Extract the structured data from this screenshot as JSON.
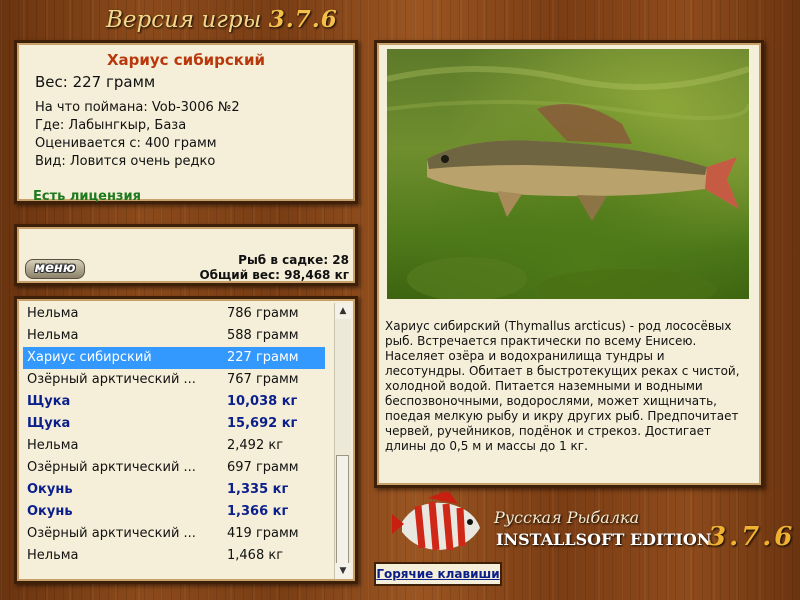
{
  "header": {
    "version_label": "Версия игры",
    "version_number": "3.7.6"
  },
  "catch": {
    "name": "Хариус сибирский",
    "weight": "Вес: 227 грамм",
    "bait": "На что поймана: Vob-3006 №2",
    "location": "Где: Лабынгкыр, База",
    "value": "Оценивается с: 400 грамм",
    "rarity": "Вид: Ловится очень редко",
    "license": "Есть лицензия"
  },
  "summary": {
    "menu_label": "меню",
    "fish_in_keepnet": "Рыб в садке: 28",
    "total_weight": "Общий вес: 98,468 кг"
  },
  "fish_list": [
    {
      "name": "Нельма",
      "weight": "786 грамм",
      "bold": false,
      "selected": false
    },
    {
      "name": "Нельма",
      "weight": "588 грамм",
      "bold": false,
      "selected": false
    },
    {
      "name": "Хариус сибирский",
      "weight": "227 грамм",
      "bold": false,
      "selected": true
    },
    {
      "name": "Озёрный арктический ...",
      "weight": "767 грамм",
      "bold": false,
      "selected": false
    },
    {
      "name": "Щука",
      "weight": "10,038 кг",
      "bold": true,
      "selected": false
    },
    {
      "name": "Щука",
      "weight": "15,692 кг",
      "bold": true,
      "selected": false
    },
    {
      "name": "Нельма",
      "weight": "2,492 кг",
      "bold": false,
      "selected": false
    },
    {
      "name": "Озёрный арктический ...",
      "weight": "697 грамм",
      "bold": false,
      "selected": false
    },
    {
      "name": "Окунь",
      "weight": "1,335 кг",
      "bold": true,
      "selected": false
    },
    {
      "name": "Окунь",
      "weight": "1,366 кг",
      "bold": true,
      "selected": false
    },
    {
      "name": "Озёрный арктический ...",
      "weight": "419 грамм",
      "bold": false,
      "selected": false
    },
    {
      "name": "Нельма",
      "weight": "1,468 кг",
      "bold": false,
      "selected": false
    }
  ],
  "description": "Хариус сибирский (Thymallus arcticus) - род лососёвых рыб. Встречается практически по всему Енисею. Населяет озёра и водохранилища тундры и лесотундры. Обитает в быстротекущих реках с чистой, холодной водой. Питается наземными и водными беспозвоночными, водорослями, может хищничать, поедая мелкую рыбу и икру других рыб. Предпочитает червей, ручейников, подёнок и стрекоз. Достигает длины до 0,5 м и массы до 1 кг.",
  "logo": {
    "title": "Русская Рыбалка",
    "edition": "INSTALLSOFT EDITION",
    "version": "3.7.6"
  },
  "hotkeys_label": "Горячие клавиши",
  "colors": {
    "title_red": "#b8380c",
    "license_green": "#1e7a1e",
    "bold_blue": "#0b1f8a",
    "selection": "#3399ff"
  }
}
